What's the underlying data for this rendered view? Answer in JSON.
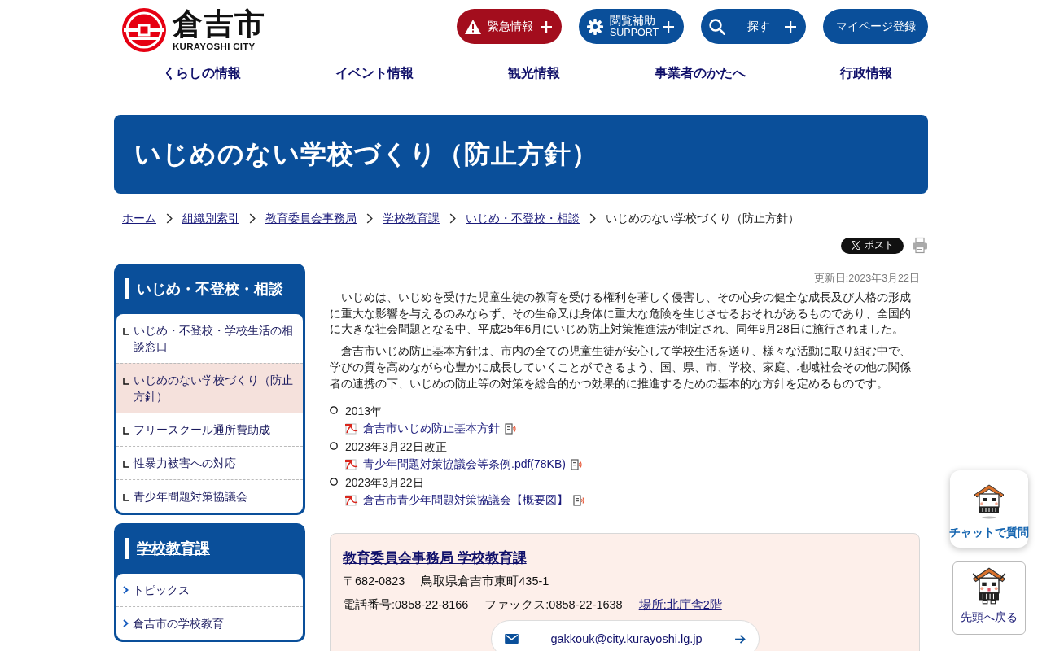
{
  "header": {
    "logo": {
      "name": "倉吉市",
      "romaji": "KURAYOSHI CITY"
    },
    "buttons": [
      {
        "kind": "emergency",
        "label": "緊急情報",
        "expandable": true
      },
      {
        "kind": "support",
        "label": "閲覧補助",
        "sublabel": "SUPPORT",
        "expandable": true
      },
      {
        "kind": "search",
        "label": "探す",
        "expandable": true
      },
      {
        "kind": "plain",
        "label": "マイページ登録",
        "expandable": false
      }
    ]
  },
  "nav": [
    "くらしの情報",
    "イベント情報",
    "観光情報",
    "事業者のかたへ",
    "行政情報"
  ],
  "page_title": "いじめのない学校づくり（防止方針）",
  "breadcrumb": [
    {
      "label": "ホーム",
      "current": false
    },
    {
      "label": "組織別索引",
      "current": false
    },
    {
      "label": "教育委員会事務局",
      "current": false
    },
    {
      "label": "学校教育課",
      "current": false
    },
    {
      "label": "いじめ・不登校・相談",
      "current": false
    },
    {
      "label": "いじめのない学校づくり（防止方針）",
      "current": true
    }
  ],
  "share": {
    "post_label": "ポスト"
  },
  "sidebar": [
    {
      "kind": "subpages",
      "title": "いじめ・不登校・相談",
      "items": [
        {
          "label": "いじめ・不登校・学校生活の相談窓口",
          "selected": false
        },
        {
          "label": "いじめのない学校づくり（防止方針）",
          "selected": true
        },
        {
          "label": "フリースクール通所費助成",
          "selected": false
        },
        {
          "label": "性暴力被害への対応",
          "selected": false
        },
        {
          "label": "青少年問題対策協議会",
          "selected": false
        }
      ]
    },
    {
      "kind": "links",
      "title": "学校教育課",
      "items": [
        {
          "label": "トピックス",
          "selected": false
        },
        {
          "label": "倉吉市の学校教育",
          "selected": false
        }
      ]
    }
  ],
  "content": {
    "updated": "更新日:2023年3月22日",
    "paragraphs": [
      "いじめは、いじめを受けた児童生徒の教育を受ける権利を著しく侵害し、その心身の健全な成長及び人格の形成に重大な影響を与えるのみならず、その生命又は身体に重大な危険を生じさせるおそれがあるものであり、全国的に大きな社会問題となる中、平成25年6月にいじめ防止対策推進法が制定され、同年9月28日に施行されました。",
      "倉吉市いじめ防止基本方針は、市内の全ての児童生徒が安心して学校生活を送り、様々な活動に取り組む中で、学びの質を高めながら心豊かに成長していくことができるよう、国、県、市、学校、家庭、地域社会その他の関係者の連携の下、いじめの防止等の対策を総合的かつ効果的に推進するための基本的な方針を定めるものです。"
    ],
    "documents": [
      {
        "date": "2013年",
        "file": "倉吉市いじめ防止基本方針"
      },
      {
        "date": "2023年3月22日改正",
        "file": "青少年問題対策協議会等条例.pdf(78KB)"
      },
      {
        "date": "2023年3月22日",
        "file": "倉吉市青少年問題対策協議会【概要図】"
      }
    ]
  },
  "contact": {
    "department": "教育委員会事務局 学校教育課",
    "postal": "〒682-0823",
    "address": "鳥取県倉吉市東町435-1",
    "phone": "電話番号:0858-22-8166",
    "fax": "ファックス:0858-22-1638",
    "location": "場所:北庁舎2階",
    "email": "gakkouk@city.kurayoshi.lg.jp"
  },
  "floating": {
    "chat_label": "チャットで質問",
    "top_label": "先頭へ戻る"
  }
}
